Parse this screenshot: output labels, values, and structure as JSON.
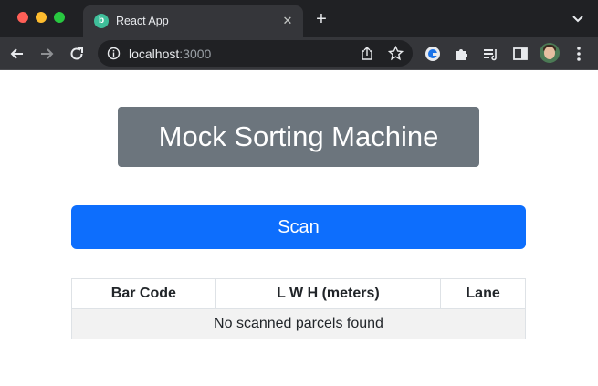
{
  "browser": {
    "tab": {
      "favicon_letter": "b",
      "title": "React App",
      "close_glyph": "✕"
    },
    "new_tab_glyph": "+",
    "url": {
      "host": "localhost",
      "port": ":3000"
    },
    "colors": {
      "chrome_dark": "#202124",
      "toolbar": "#35363a"
    }
  },
  "page": {
    "title": "Mock Sorting Machine",
    "scan_button_label": "Scan",
    "table": {
      "headers": [
        "Bar Code",
        "L W H (meters)",
        "Lane"
      ],
      "empty_message": "No scanned parcels found"
    },
    "colors": {
      "title_bg": "#6c757d",
      "primary": "#0d6efd"
    }
  }
}
